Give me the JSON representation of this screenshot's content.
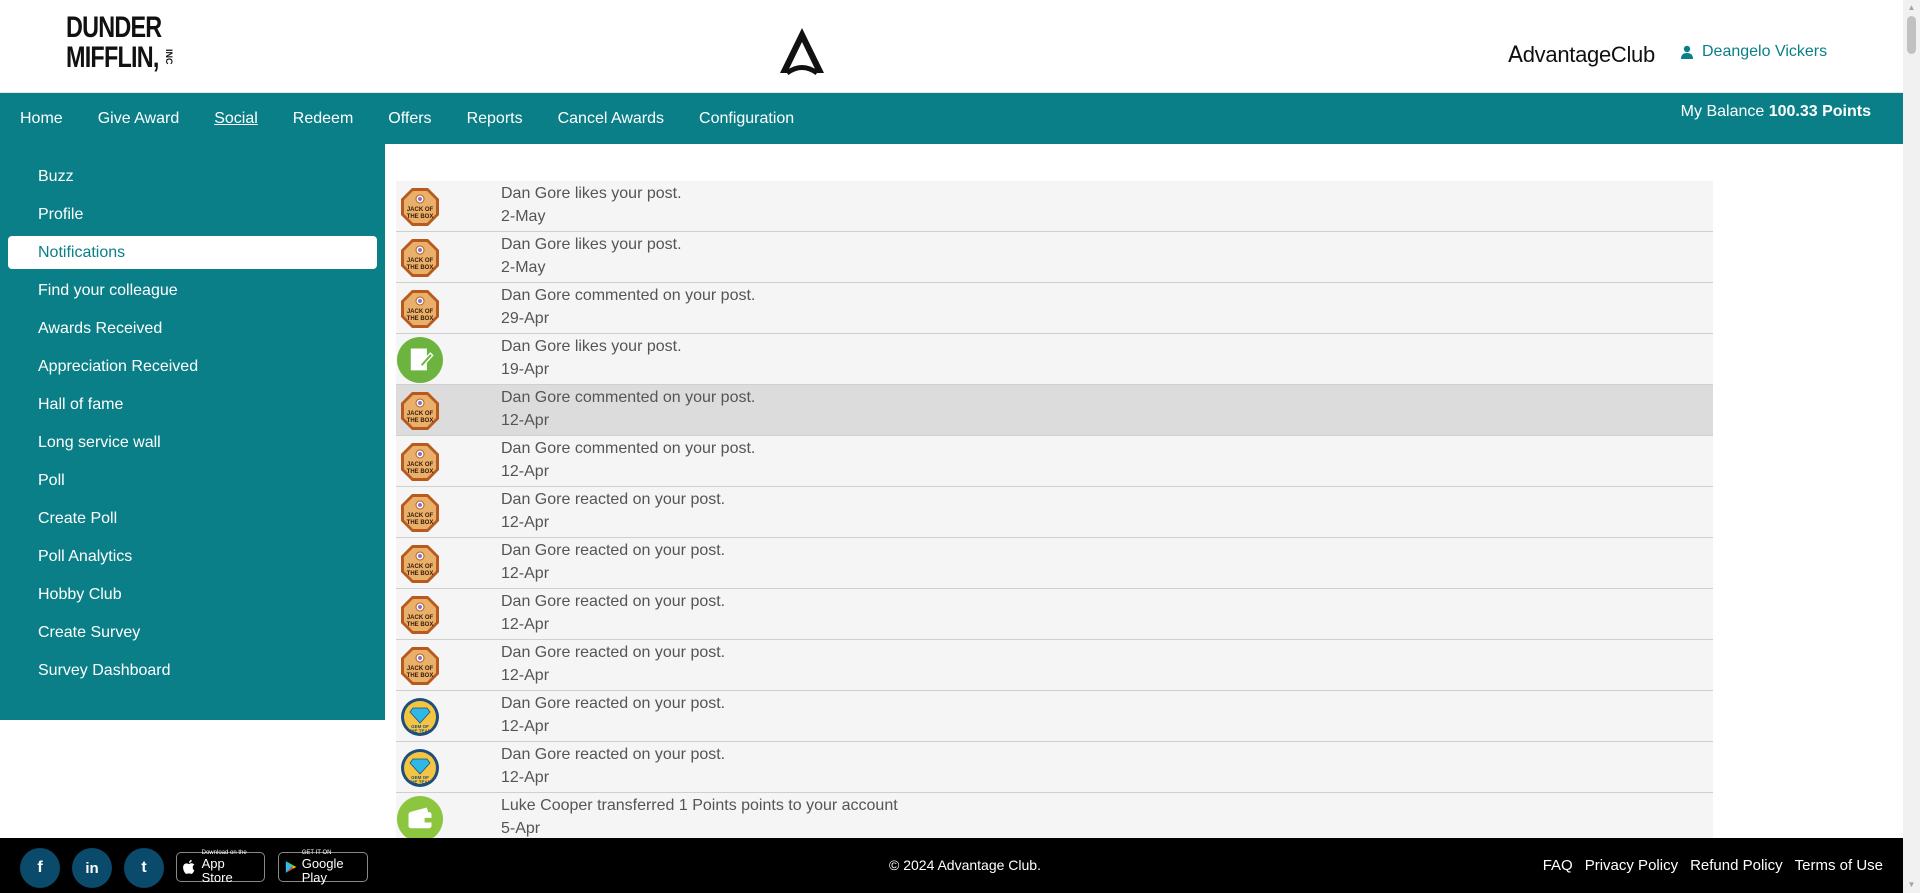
{
  "header": {
    "logo_line1": "DUNDER",
    "logo_line2": "MIFFLIN,",
    "logo_inc": "INC",
    "brand_name": "dvantageClub",
    "brand_initial": "A",
    "user_name": "Deangelo Vickers"
  },
  "nav": {
    "items": [
      {
        "label": "Home"
      },
      {
        "label": "Give Award"
      },
      {
        "label": "Social"
      },
      {
        "label": "Redeem"
      },
      {
        "label": "Offers"
      },
      {
        "label": "Reports"
      },
      {
        "label": "Cancel Awards"
      },
      {
        "label": "Configuration"
      }
    ],
    "active": "Social",
    "balance_label": "My Balance",
    "balance_value": "100.33 Points"
  },
  "sidebar": {
    "items": [
      {
        "label": "Buzz"
      },
      {
        "label": "Profile"
      },
      {
        "label": "Notifications"
      },
      {
        "label": "Find your colleague"
      },
      {
        "label": "Awards Received"
      },
      {
        "label": "Appreciation Received"
      },
      {
        "label": "Hall of fame"
      },
      {
        "label": "Long service wall"
      },
      {
        "label": "Poll"
      },
      {
        "label": "Create Poll"
      },
      {
        "label": "Poll Analytics"
      },
      {
        "label": "Hobby Club"
      },
      {
        "label": "Create Survey"
      },
      {
        "label": "Survey Dashboard"
      }
    ],
    "active": "Notifications"
  },
  "notifications": [
    {
      "message": "Dan Gore likes your post.",
      "date": "2-May",
      "badge": "jack-of-the-box",
      "badge_text": "JACK OF THE BOX"
    },
    {
      "message": "Dan Gore likes your post.",
      "date": "2-May",
      "badge": "jack-of-the-box",
      "badge_text": "JACK OF THE BOX"
    },
    {
      "message": "Dan Gore commented on your post.",
      "date": "29-Apr",
      "badge": "jack-of-the-box",
      "badge_text": "JACK OF THE BOX"
    },
    {
      "message": "Dan Gore likes your post.",
      "date": "19-Apr",
      "badge": "note",
      "badge_text": ""
    },
    {
      "message": "Dan Gore commented on your post.",
      "date": "12-Apr",
      "badge": "jack-of-the-box",
      "badge_text": "JACK OF THE BOX",
      "highlight": true
    },
    {
      "message": "Dan Gore commented on your post.",
      "date": "12-Apr",
      "badge": "jack-of-the-box",
      "badge_text": "JACK OF THE BOX"
    },
    {
      "message": "Dan Gore reacted on your post.",
      "date": "12-Apr",
      "badge": "jack-of-the-box",
      "badge_text": "JACK OF THE BOX"
    },
    {
      "message": "Dan Gore reacted on your post.",
      "date": "12-Apr",
      "badge": "jack-of-the-box",
      "badge_text": "JACK OF THE BOX"
    },
    {
      "message": "Dan Gore reacted on your post.",
      "date": "12-Apr",
      "badge": "jack-of-the-box",
      "badge_text": "JACK OF THE BOX"
    },
    {
      "message": "Dan Gore reacted on your post.",
      "date": "12-Apr",
      "badge": "jack-of-the-box",
      "badge_text": "JACK OF THE BOX"
    },
    {
      "message": "Dan Gore reacted on your post.",
      "date": "12-Apr",
      "badge": "gem-of-the-team",
      "badge_text": "GEM OF THE TEAM"
    },
    {
      "message": "Dan Gore reacted on your post.",
      "date": "12-Apr",
      "badge": "gem-of-the-team",
      "badge_text": "GEM OF THE TEAM"
    },
    {
      "message": "Luke Cooper transferred 1 Points points to your account",
      "date": "5-Apr",
      "badge": "wallet",
      "badge_text": ""
    }
  ],
  "footer": {
    "social": [
      {
        "name": "facebook-icon",
        "glyph": "f"
      },
      {
        "name": "linkedin-icon",
        "glyph": "in"
      },
      {
        "name": "twitter-icon",
        "glyph": "t"
      }
    ],
    "app_store": {
      "small": "Download on the",
      "big": "App Store"
    },
    "google_play": {
      "small": "GET IT ON",
      "big": "Google Play"
    },
    "copyright": "© 2024 Advantage Club.",
    "links": [
      {
        "label": "FAQ"
      },
      {
        "label": "Privacy Policy"
      },
      {
        "label": "Refund Policy"
      },
      {
        "label": "Terms of Use"
      }
    ]
  },
  "colors": {
    "accent": "#0a7f88",
    "badge_brown": "#b85a1e",
    "badge_green": "#6db33f",
    "badge_gem_ring": "#1f4e7a"
  }
}
